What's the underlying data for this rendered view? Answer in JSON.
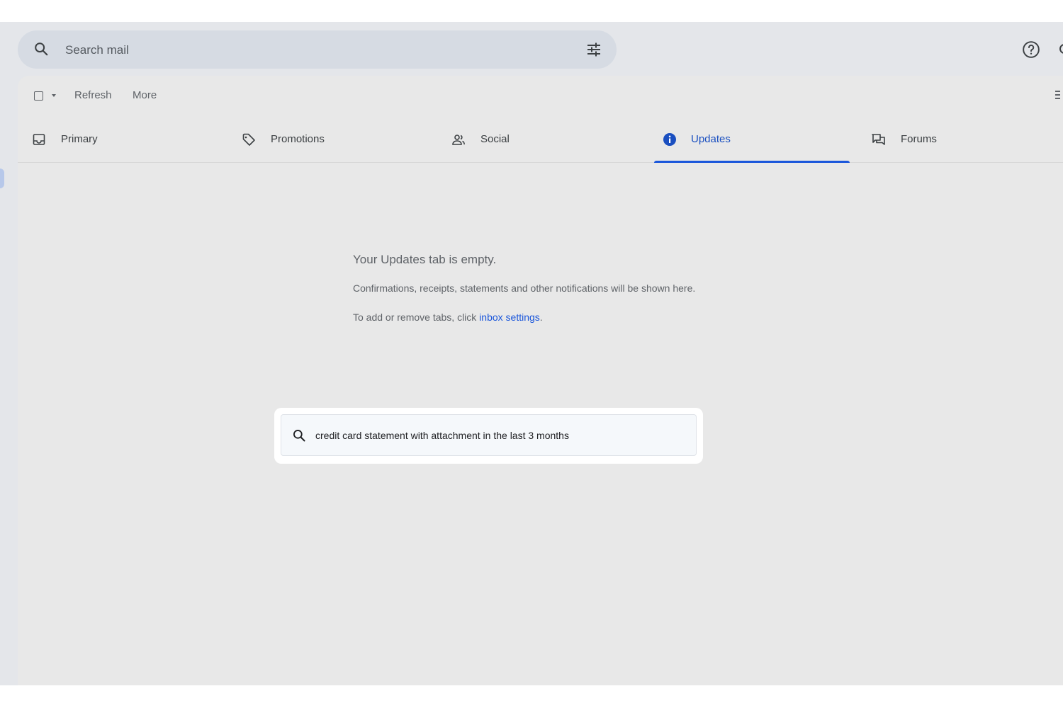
{
  "search": {
    "placeholder": "Search mail"
  },
  "toolbar": {
    "refresh_label": "Refresh",
    "more_label": "More"
  },
  "tabs": [
    {
      "label": "Primary",
      "icon": "inbox-icon",
      "active": false
    },
    {
      "label": "Promotions",
      "icon": "tag-icon",
      "active": false
    },
    {
      "label": "Social",
      "icon": "people-icon",
      "active": false
    },
    {
      "label": "Updates",
      "icon": "info-icon",
      "active": true
    },
    {
      "label": "Forums",
      "icon": "forum-icon",
      "active": false
    }
  ],
  "empty_state": {
    "title": "Your Updates tab is empty.",
    "subtitle": "Confirmations, receipts, statements and other notifications will be shown here.",
    "hint_prefix": "To add or remove tabs, click ",
    "hint_link": "inbox settings",
    "hint_suffix": "."
  },
  "suggestion": {
    "query": "credit card statement with attachment in the last 3 months"
  },
  "colors": {
    "accent": "#1a56db",
    "background": "#e4e6ea",
    "search_bg": "#d6dbe3"
  }
}
